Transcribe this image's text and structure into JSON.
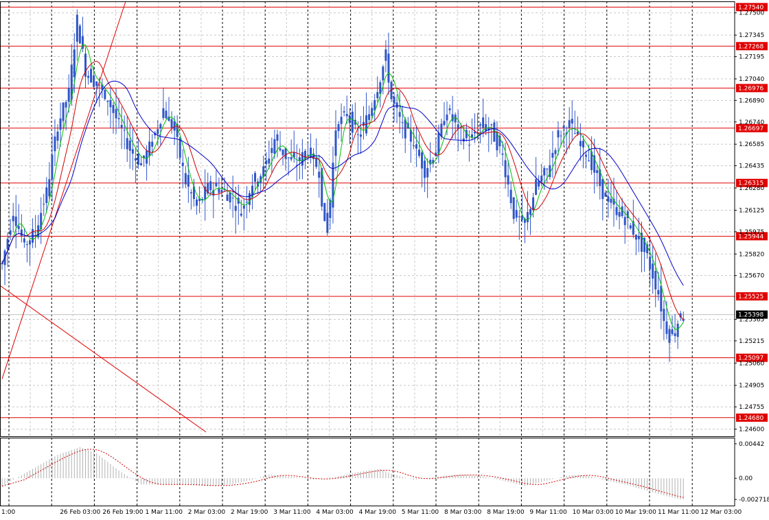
{
  "chart_data": [
    {
      "type": "candlestick",
      "title": "",
      "colors": {
        "bull": "#2f55c8",
        "bear": "#2f55c8",
        "ma_fast": "#00c000",
        "ma_mid": "#d00000",
        "ma_slow": "#0000c8",
        "levels": "#e00000",
        "trendline": "#e00000",
        "grid": "#c8c8c8"
      },
      "ylim": [
        1.2455,
        1.2758
      ],
      "y_ticks": [
        "1.27500",
        "1.27345",
        "1.27195",
        "1.27040",
        "1.26890",
        "1.26740",
        "1.26585",
        "1.26435",
        "1.26280",
        "1.26125",
        "1.25975",
        "1.25820",
        "1.25670",
        "1.25365",
        "1.25215",
        "1.25060",
        "1.24905",
        "1.24755",
        "1.24600"
      ],
      "x_ticks": [
        "1:00",
        "26 Feb 03:00",
        "26 Feb 19:00",
        "1 Mar 11:00",
        "2 Mar 03:00",
        "2 Mar 19:00",
        "3 Mar 11:00",
        "4 Mar 03:00",
        "4 Mar 19:00",
        "5 Mar 11:00",
        "8 Mar 03:00",
        "8 Mar 19:00",
        "9 Mar 11:00",
        "10 Mar 03:00",
        "10 Mar 19:00",
        "11 Mar 11:00",
        "12 Mar 03:00"
      ],
      "levels": [
        "1.27540",
        "1.27268",
        "1.26976",
        "1.26697",
        "1.26315",
        "1.25944",
        "1.25525",
        "1.25097",
        "1.24680"
      ],
      "current_price": "1.25398",
      "close_anchors": [
        [
          0,
          1.2575
        ],
        [
          4,
          1.2612
        ],
        [
          8,
          1.2588
        ],
        [
          12,
          1.2598
        ],
        [
          16,
          1.2625
        ],
        [
          20,
          1.2672
        ],
        [
          24,
          1.2694
        ],
        [
          27,
          1.2745
        ],
        [
          30,
          1.271
        ],
        [
          34,
          1.27
        ],
        [
          38,
          1.269
        ],
        [
          42,
          1.2672
        ],
        [
          46,
          1.2655
        ],
        [
          50,
          1.2645
        ],
        [
          54,
          1.266
        ],
        [
          58,
          1.2683
        ],
        [
          62,
          1.2668
        ],
        [
          66,
          1.2632
        ],
        [
          70,
          1.2615
        ],
        [
          74,
          1.2628
        ],
        [
          78,
          1.2628
        ],
        [
          82,
          1.2622
        ],
        [
          86,
          1.2612
        ],
        [
          90,
          1.2632
        ],
        [
          94,
          1.264
        ],
        [
          98,
          1.2662
        ],
        [
          102,
          1.265
        ],
        [
          106,
          1.2645
        ],
        [
          110,
          1.2655
        ],
        [
          114,
          1.264
        ],
        [
          116,
          1.26
        ],
        [
          118,
          1.262
        ],
        [
          120,
          1.267
        ],
        [
          124,
          1.268
        ],
        [
          128,
          1.2663
        ],
        [
          132,
          1.268
        ],
        [
          136,
          1.2705
        ],
        [
          138,
          1.272
        ],
        [
          140,
          1.269
        ],
        [
          144,
          1.267
        ],
        [
          148,
          1.266
        ],
        [
          152,
          1.264
        ],
        [
          156,
          1.2655
        ],
        [
          160,
          1.2683
        ],
        [
          164,
          1.2668
        ],
        [
          168,
          1.266
        ],
        [
          172,
          1.2672
        ],
        [
          176,
          1.2668
        ],
        [
          180,
          1.265
        ],
        [
          184,
          1.261
        ],
        [
          188,
          1.2602
        ],
        [
          192,
          1.263
        ],
        [
          196,
          1.264
        ],
        [
          200,
          1.2665
        ],
        [
          204,
          1.2672
        ],
        [
          208,
          1.266
        ],
        [
          212,
          1.2645
        ],
        [
          216,
          1.2625
        ],
        [
          220,
          1.2614
        ],
        [
          224,
          1.2607
        ],
        [
          228,
          1.2595
        ],
        [
          232,
          1.258
        ],
        [
          236,
          1.2555
        ],
        [
          238,
          1.2535
        ],
        [
          240,
          1.2525
        ],
        [
          242,
          1.253
        ],
        [
          244,
          1.254
        ]
      ],
      "macd_ylim": [
        -0.0035,
        0.0052
      ],
      "macd_ticks": [
        "0.00442",
        "0.00",
        "-0.002718"
      ],
      "macd_anchors": [
        [
          0,
          -0.001
        ],
        [
          10,
          0.001
        ],
        [
          20,
          0.003
        ],
        [
          28,
          0.004
        ],
        [
          34,
          0.0032
        ],
        [
          42,
          0.001
        ],
        [
          50,
          -0.0008
        ],
        [
          58,
          -0.0008
        ],
        [
          66,
          -0.0008
        ],
        [
          74,
          -0.001
        ],
        [
          82,
          -0.0008
        ],
        [
          90,
          -0.0002
        ],
        [
          96,
          0.0005
        ],
        [
          104,
          0.0002
        ],
        [
          112,
          -0.0002
        ],
        [
          120,
          0.0002
        ],
        [
          128,
          0.0008
        ],
        [
          136,
          0.0012
        ],
        [
          140,
          0.0006
        ],
        [
          148,
          -0.0002
        ],
        [
          156,
          0.0002
        ],
        [
          164,
          0.0005
        ],
        [
          172,
          0.0003
        ],
        [
          180,
          -0.0003
        ],
        [
          188,
          -0.001
        ],
        [
          196,
          -0.0003
        ],
        [
          204,
          0.0004
        ],
        [
          210,
          0.0004
        ],
        [
          216,
          -0.0002
        ],
        [
          224,
          -0.0008
        ],
        [
          232,
          -0.0016
        ],
        [
          240,
          -0.0024
        ],
        [
          244,
          -0.0027
        ]
      ]
    }
  ]
}
